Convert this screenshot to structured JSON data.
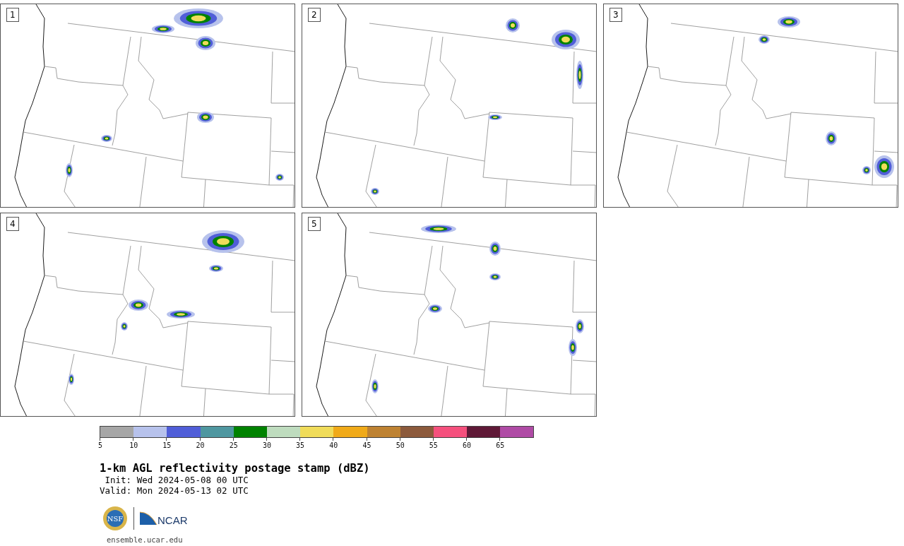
{
  "panels": [
    {
      "label": "1"
    },
    {
      "label": "2"
    },
    {
      "label": "3"
    },
    {
      "label": "4"
    },
    {
      "label": "5"
    }
  ],
  "colorbar": {
    "segments": [
      {
        "tick": "5",
        "color": "#a6a6a6"
      },
      {
        "tick": "10",
        "color": "#b7c2ec"
      },
      {
        "tick": "15",
        "color": "#505ed8"
      },
      {
        "tick": "20",
        "color": "#4f97a0"
      },
      {
        "tick": "25",
        "color": "#008200"
      },
      {
        "tick": "30",
        "color": "#bedcbe"
      },
      {
        "tick": "35",
        "color": "#f0dc5a"
      },
      {
        "tick": "40",
        "color": "#f0aa19"
      },
      {
        "tick": "45",
        "color": "#be8232"
      },
      {
        "tick": "50",
        "color": "#8c5a3c"
      },
      {
        "tick": "55",
        "color": "#f5507d"
      },
      {
        "tick": "60",
        "color": "#5f1937"
      },
      {
        "tick": "65",
        "color": "#af4ba5"
      }
    ]
  },
  "title": "1-km AGL reflectivity postage stamp (dBZ)",
  "init": "Init: Wed 2024-05-08 00 UTC",
  "valid": "Valid: Mon 2024-05-13 02 UTC",
  "logos": {
    "left": "NSF",
    "right": "NCAR"
  },
  "footer": "ensemble.ucar.edu"
}
